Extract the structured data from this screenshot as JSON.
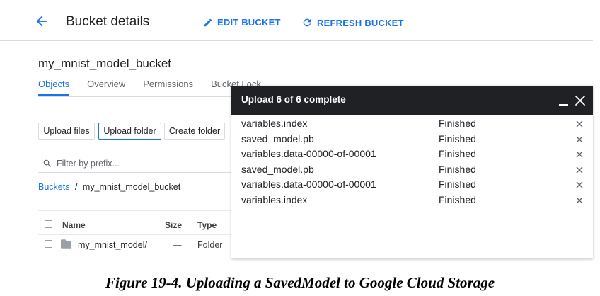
{
  "header": {
    "title": "Bucket details",
    "edit_label": "EDIT BUCKET",
    "refresh_label": "REFRESH BUCKET"
  },
  "bucket": {
    "name": "my_mnist_model_bucket"
  },
  "tabs": [
    {
      "label": "Objects",
      "active": true
    },
    {
      "label": "Overview",
      "active": false
    },
    {
      "label": "Permissions",
      "active": false
    },
    {
      "label": "Bucket Lock",
      "active": false
    }
  ],
  "toolbar": {
    "upload_files": "Upload files",
    "upload_folder": "Upload folder",
    "create_folder": "Create folder"
  },
  "filter": {
    "placeholder": "Filter by prefix..."
  },
  "breadcrumb": {
    "root": "Buckets",
    "separator": "/",
    "current": "my_mnist_model_bucket"
  },
  "table": {
    "columns": [
      "Name",
      "Size",
      "Type"
    ],
    "rows": [
      {
        "name": "my_mnist_model/",
        "size": "—",
        "type": "Folder"
      }
    ]
  },
  "upload_panel": {
    "title": "Upload 6 of 6 complete",
    "items": [
      {
        "name": "variables.index",
        "status": "Finished"
      },
      {
        "name": "saved_model.pb",
        "status": "Finished"
      },
      {
        "name": "variables.data-00000-of-00001",
        "status": "Finished"
      },
      {
        "name": "saved_model.pb",
        "status": "Finished"
      },
      {
        "name": "variables.data-00000-of-00001",
        "status": "Finished"
      },
      {
        "name": "variables.index",
        "status": "Finished"
      }
    ]
  },
  "caption": "Figure 19-4. Uploading a SavedModel to Google Cloud Storage",
  "colors": {
    "accent": "#1a73e8",
    "panel_header": "#202124",
    "border": "#dadce0"
  }
}
